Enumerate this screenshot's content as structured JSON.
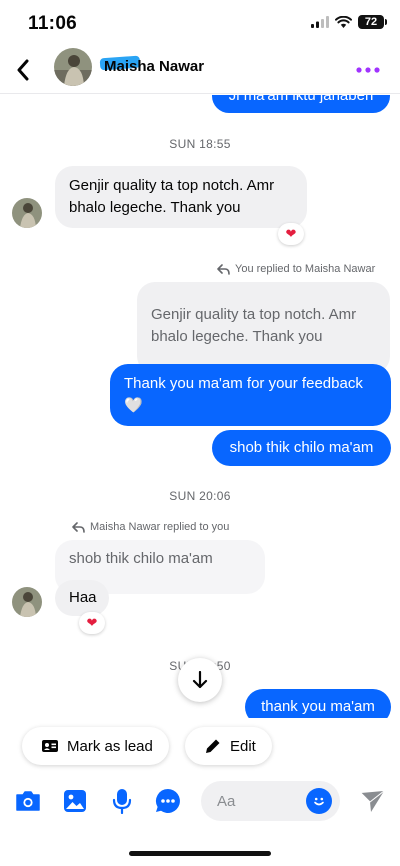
{
  "status_bar": {
    "time": "11:06",
    "battery": "72"
  },
  "header": {
    "contact_name": "Maisha Nawar"
  },
  "colors": {
    "accent": "#0866ff",
    "more_icon": "#a033ff",
    "incoming_bubble": "#f0f0f2",
    "heart": "#e41e3f"
  },
  "messages": {
    "top_partial": "Ji ma'am iktu janaben",
    "sep1": "SUN 18:55",
    "in1": "Genjir quality ta top notch. Amr bhalo legeche. Thank you",
    "in1_reaction": "❤",
    "reply_note_out": "You replied to Maisha Nawar",
    "quote_out": "Genjir quality ta top notch. Amr bhalo legeche. Thank you",
    "out1": "Thank you ma'am for your feedback",
    "out1_emoji": "🤍",
    "out2": "shob thik chilo ma'am",
    "sep2": "SUN 20:06",
    "reply_note_in": "Maisha Nawar replied to you",
    "quote_in": "shob thik chilo ma'am",
    "in2": "Haa",
    "in2_reaction": "❤",
    "sep3": "SUN 21:50",
    "out_bottom_partial": "thank you ma'am"
  },
  "actions": {
    "mark_as_lead": "Mark as lead",
    "edit": "Edit"
  },
  "composer": {
    "placeholder": "Aa"
  },
  "icons": [
    "back-arrow-icon",
    "more-dots-icon",
    "reply-arrow-icon",
    "heart-icon",
    "arrow-down-icon",
    "lead-card-icon",
    "pencil-icon",
    "camera-icon",
    "gallery-icon",
    "microphone-icon",
    "chat-options-icon",
    "emoji-smile-icon",
    "send-icon"
  ]
}
